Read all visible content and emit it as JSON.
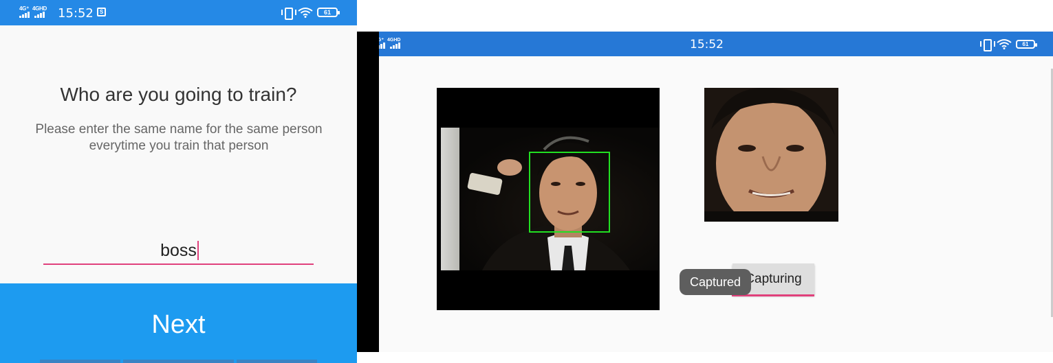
{
  "left_screen": {
    "status_bar": {
      "signal_1": "4G⁺",
      "signal_2": "4GHD",
      "time": "15:52",
      "sim_icon_label": "S",
      "battery": "61"
    },
    "title": "Who are you going to train?",
    "subtitle": "Please enter the same name for the same person everytime you train that person",
    "name_input": {
      "value": "boss"
    },
    "next_button_label": "Next"
  },
  "right_screen": {
    "status_bar": {
      "signal_1": "4G⁺",
      "signal_2": "4GHD",
      "time": "15:52",
      "battery": "61"
    },
    "capture_button_label": "Capturing",
    "toast_text": "Captured"
  },
  "colors": {
    "status_bar": "#2589e6",
    "next_button": "#1d9bf0",
    "input_underline": "#e0407b",
    "face_box": "#22e022",
    "toast_bg": "#5e5e5e"
  },
  "icons": [
    "signal-icon",
    "sim-icon",
    "vibrate-icon",
    "wifi-icon",
    "battery-icon"
  ]
}
